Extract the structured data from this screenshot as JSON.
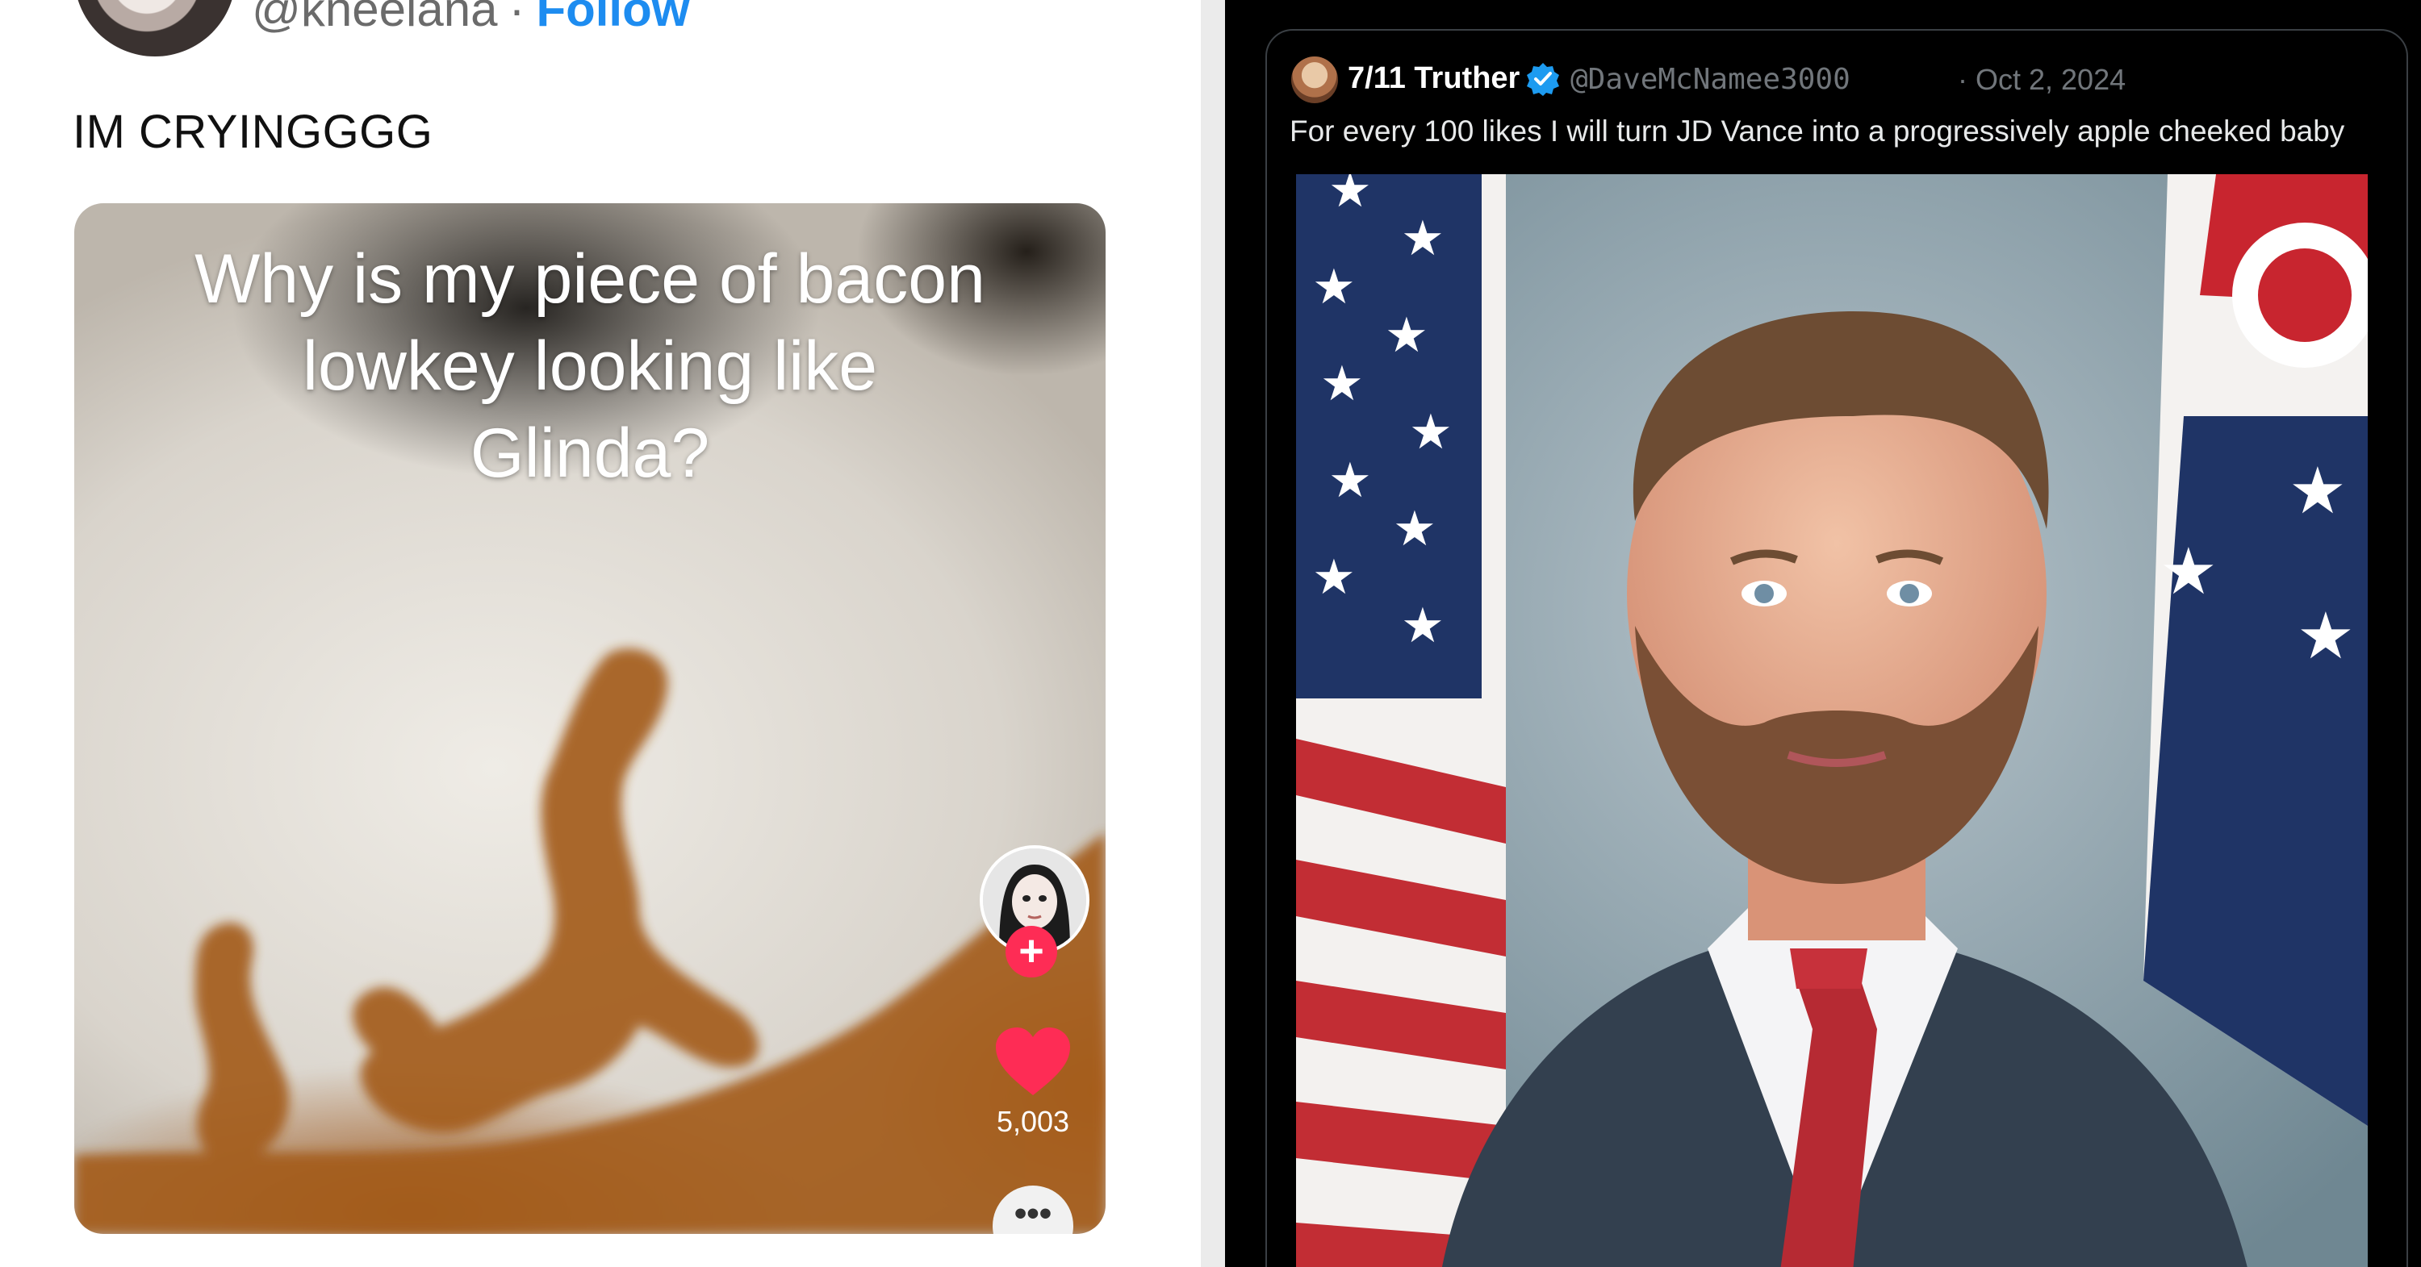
{
  "left_tweet": {
    "handle": "@kneelana",
    "separator": "·",
    "follow_label": "Follow",
    "text": "IM CRYINGGGG",
    "tiktok": {
      "caption_lines": [
        "Why is my piece of bacon",
        "lowkey looking like",
        "Glinda?"
      ],
      "plus_symbol": "+",
      "like_count": "5,003",
      "more_symbol": "•••"
    }
  },
  "right_tweet": {
    "quoted": {
      "display_name": "7/11 Truther",
      "handle": "@DaveMcNamee3000",
      "date": "· Oct 2, 2024",
      "text": "For every 100 likes I will turn JD Vance into a progressively apple cheeked baby"
    }
  },
  "colors": {
    "follow_blue": "#1d8cf0",
    "tiktok_red": "#fe2c55",
    "verified_blue": "#1d9bf0",
    "dark_bg": "#000000"
  },
  "icons": [
    "heart-icon",
    "plus-icon",
    "more-icon",
    "verified-badge-icon"
  ]
}
